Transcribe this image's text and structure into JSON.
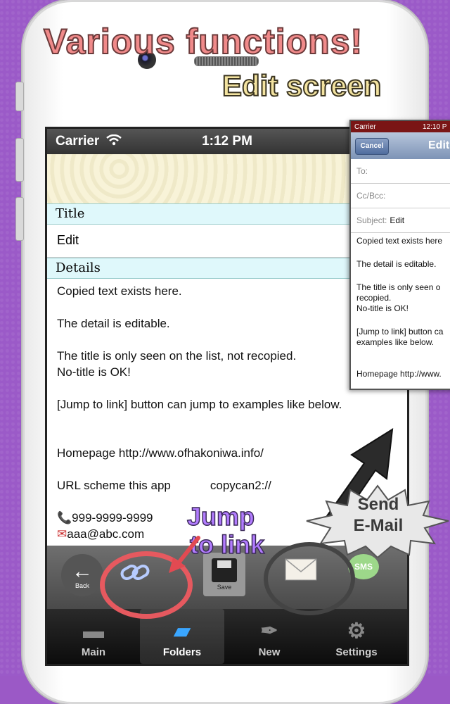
{
  "promo": {
    "headline1": "Various functions!",
    "headline2": "Edit screen",
    "jump_label_line1": "Jump",
    "jump_label_line2": "to link",
    "send_label_line1": "Send",
    "send_label_line2": "E-Mail"
  },
  "status_bar": {
    "carrier": "Carrier",
    "time": "1:12 PM"
  },
  "form": {
    "title_header": "Title",
    "title_value": "Edit",
    "details_header": "Details",
    "details_lines": [
      "Copied text exists here.",
      "The detail is editable.",
      "The title is only seen on the list, not recopied.",
      "No-title is OK!",
      "[Jump to link] button can jump to examples like below.",
      "Homepage http://www.ofhakoniwa.info/",
      "URL scheme this app",
      "copycan2://",
      "999-9999-9999",
      "aaa@abc.com"
    ]
  },
  "toolbar": {
    "back_label": "Back",
    "save_label": "Save",
    "sms_label": "SMS"
  },
  "tabs": [
    {
      "label": "Main",
      "icon": "page-icon"
    },
    {
      "label": "Folders",
      "icon": "folder-icon"
    },
    {
      "label": "New",
      "icon": "quill-icon"
    },
    {
      "label": "Settings",
      "icon": "gear-icon"
    }
  ],
  "email_preview": {
    "carrier": "Carrier",
    "time": "12:10 P",
    "cancel_label": "Cancel",
    "title": "Edit",
    "to_label": "To:",
    "cc_label": "Cc/Bcc:",
    "subject_label": "Subject:",
    "subject_value": "Edit",
    "body_lines": [
      "Copied text exists here",
      "The detail is editable.",
      "The title is only seen o",
      "recopied.",
      "No-title is OK!",
      "[Jump to link] button ca",
      "examples like below.",
      "Homepage http://www."
    ]
  },
  "colors": {
    "background": "#9b5ac8",
    "accent_red": "#e6595f",
    "accent_blue": "#3aa6ff",
    "header_cyan": "#dff8fb"
  }
}
